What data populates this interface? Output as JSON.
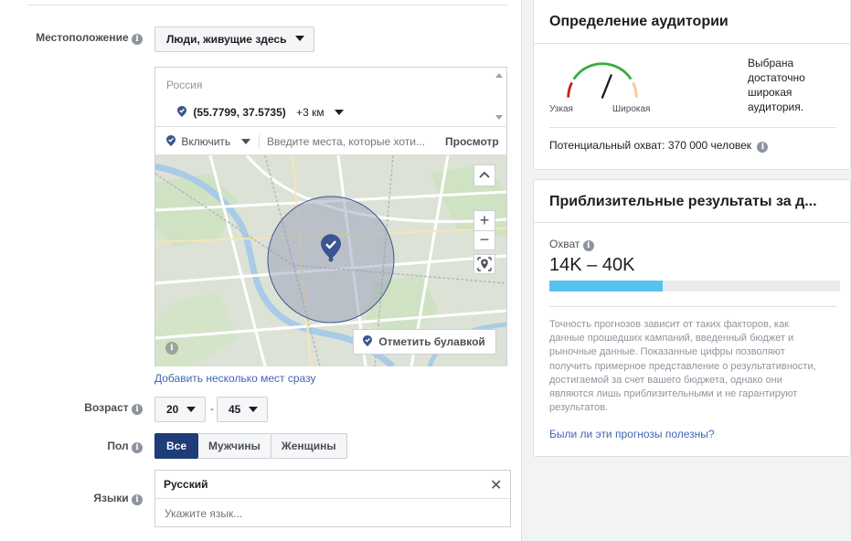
{
  "location": {
    "label": "Местоположение",
    "dropdown_value": "Люди, живущие здесь",
    "country": "Россия",
    "point": "(55.7799, 37.5735)",
    "radius": "+3 км",
    "include_label": "Включить",
    "places_placeholder": "Введите места, которые хоти...",
    "view_button": "Просмотр",
    "drop_pin_button": "Отметить булавкой",
    "add_multiple_link": "Добавить несколько мест сразу"
  },
  "age": {
    "label": "Возраст",
    "from": "20",
    "to": "45",
    "separator": "-"
  },
  "gender": {
    "label": "Пол",
    "options": [
      "Все",
      "Мужчины",
      "Женщины"
    ],
    "selected": "Все"
  },
  "languages": {
    "label": "Языки",
    "selected": "Русский",
    "placeholder": "Укажите язык..."
  },
  "audience": {
    "title": "Определение аудитории",
    "gauge_narrow": "Узкая",
    "gauge_wide": "Широкая",
    "gauge_level": 0.62,
    "description": "Выбрана достаточно широкая аудитория.",
    "potential_reach": "Потенциальный охват: 370 000 человек"
  },
  "estimates": {
    "title": "Приблизительные результаты за д...",
    "reach_label": "Охват",
    "reach_value": "14K – 40K",
    "reach_bar_fraction": 0.39,
    "disclaimer": "Точность прогнозов зависит от таких факторов, как данные прошедших кампаний, введенный бюджет и рыночные данные. Показанные цифры позволяют получить примерное представление о результативности, достигаемой за счет вашего бюджета, однако они являются лишь приблизительными и не гарантируют результатов.",
    "feedback_link": "Были ли эти прогнозы полезны?"
  },
  "colors": {
    "accent": "#4267b2",
    "selected_button": "#1d3c78",
    "reach_bar": "#56c3ef",
    "gauge_red": "#c5221f",
    "gauge_green": "#3bab44",
    "gauge_orange": "#f7c88e",
    "pin": "#3b5590"
  }
}
